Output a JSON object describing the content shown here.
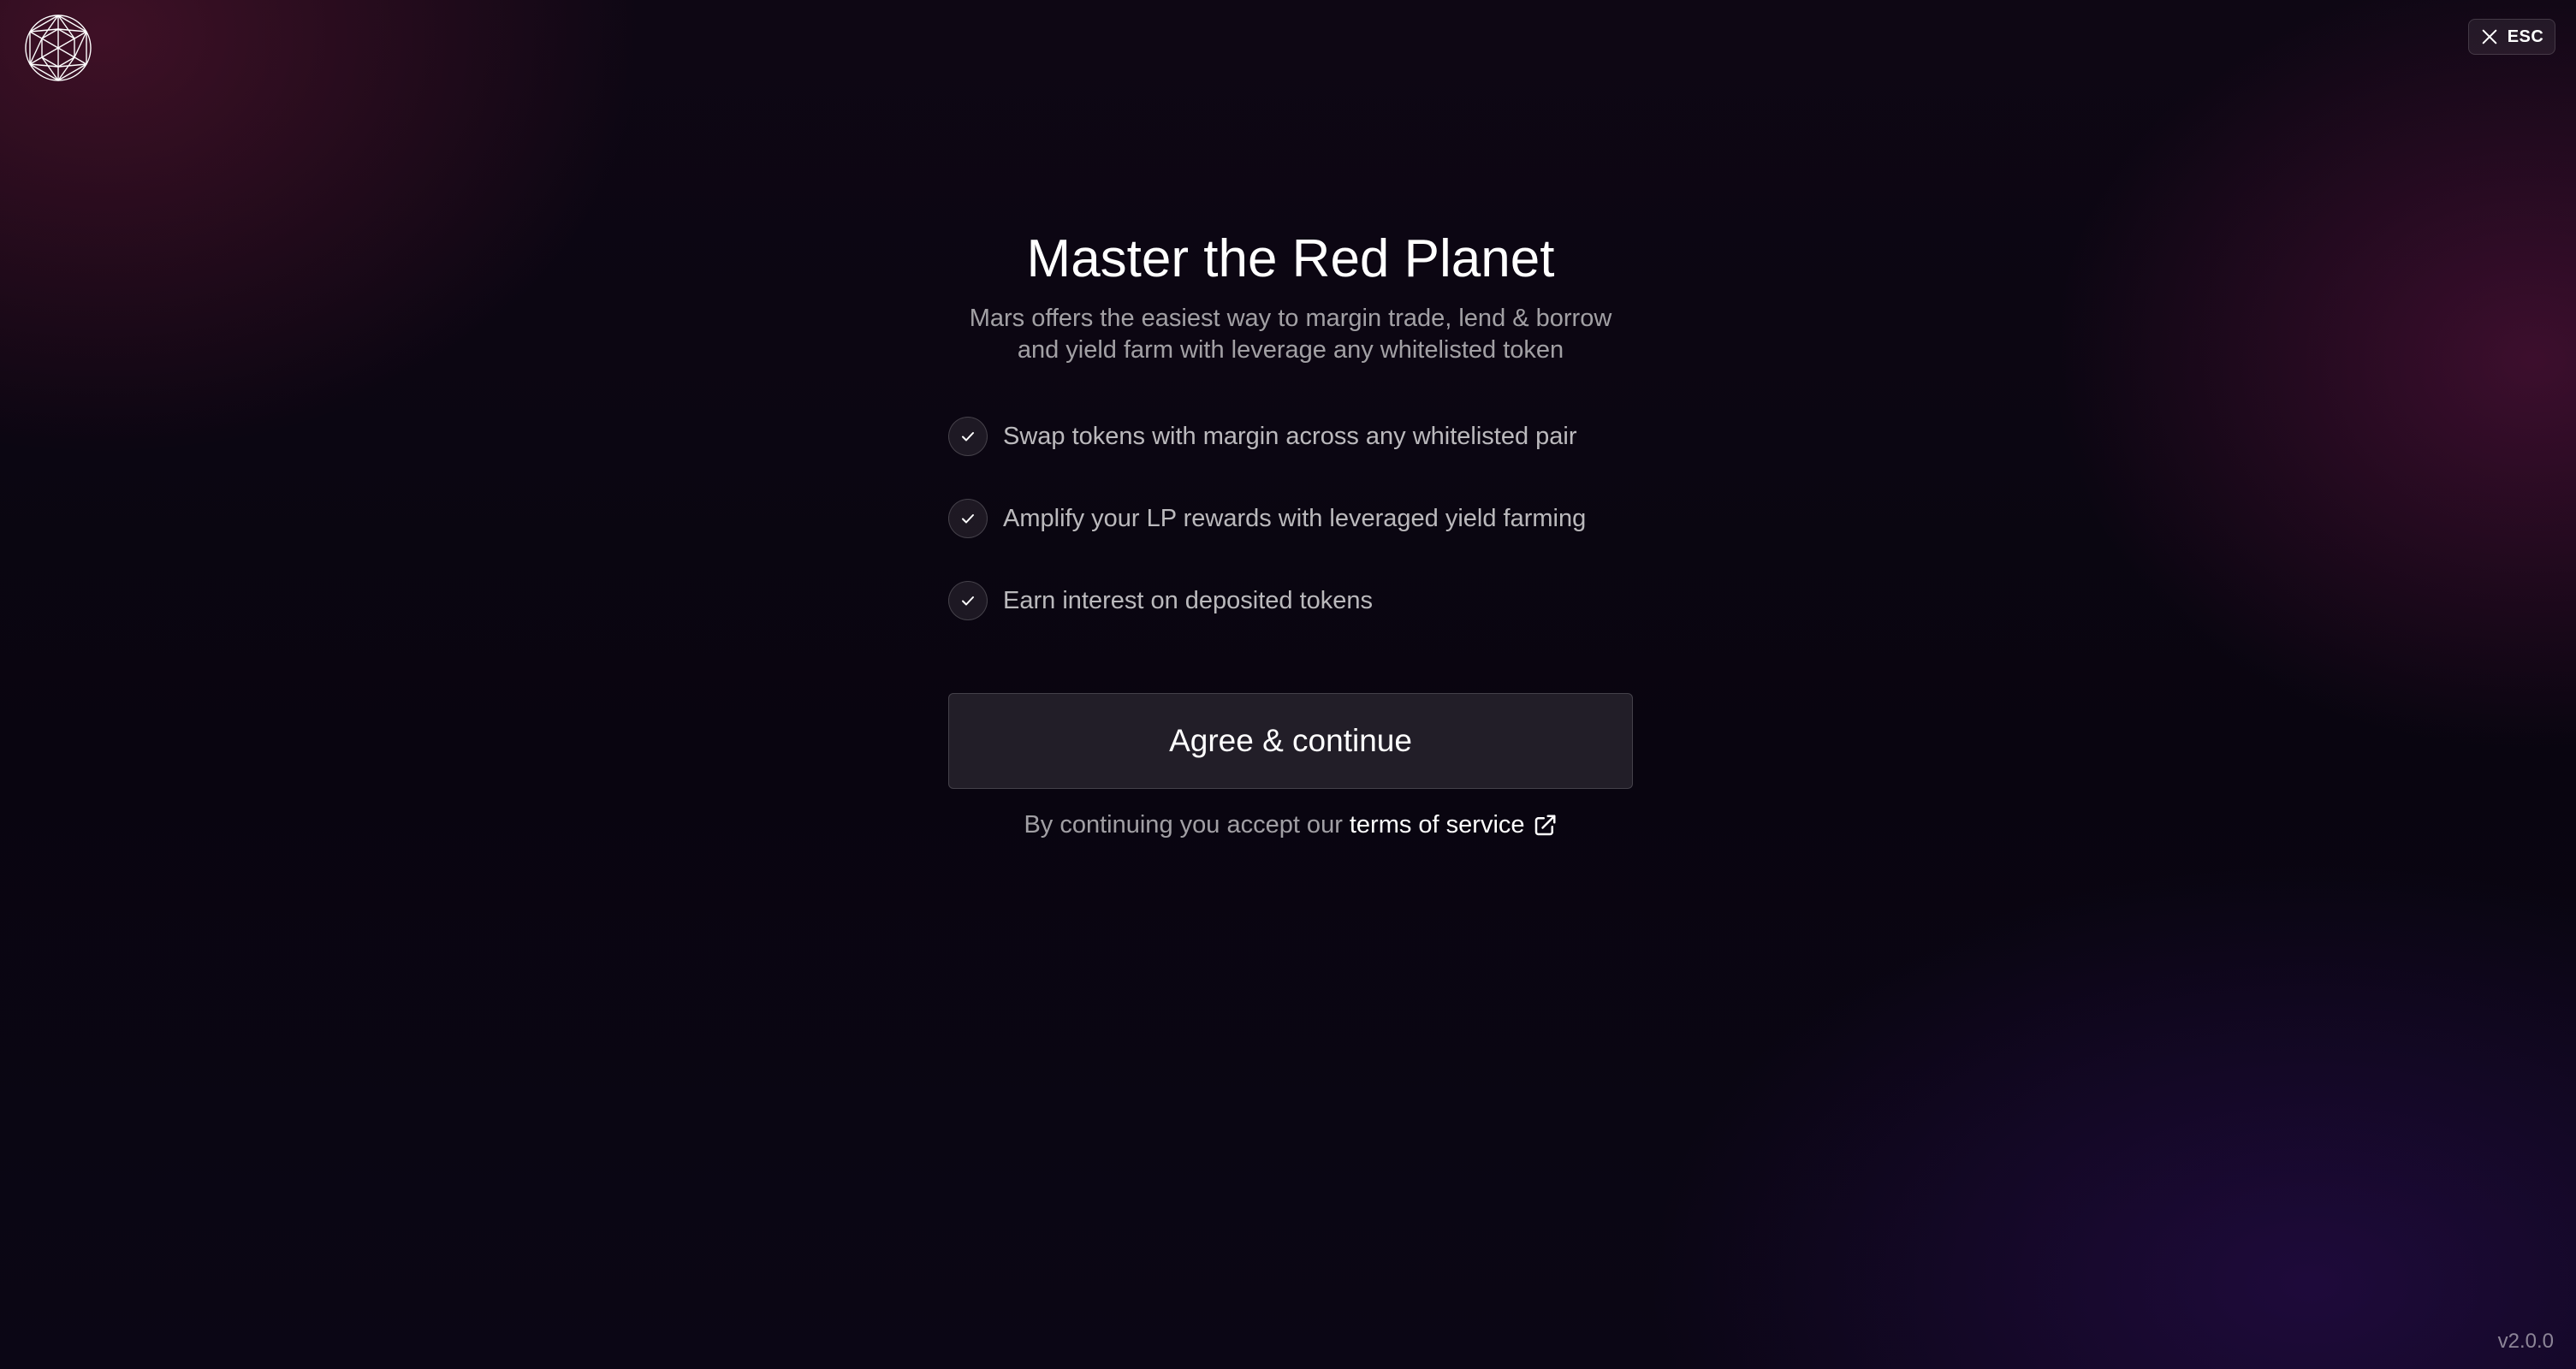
{
  "header": {
    "logo_icon": "mars-protocol-logo-icon",
    "close_icon": "close-icon",
    "esc_label": "ESC"
  },
  "main": {
    "title": "Master the Red Planet",
    "subtitle": "Mars offers the easiest way to margin trade, lend & borrow and yield farm with leverage any whitelisted token",
    "features": [
      {
        "icon": "check-icon",
        "text": "Swap tokens with margin across any whitelisted pair"
      },
      {
        "icon": "check-icon",
        "text": "Amplify your LP rewards with leveraged yield farming"
      },
      {
        "icon": "check-icon",
        "text": "Earn interest on deposited tokens"
      }
    ],
    "agree_button_label": "Agree & continue",
    "terms_prefix": "By continuing you accept our",
    "terms_link_label": "terms of service",
    "terms_link_icon": "external-link-icon"
  },
  "footer": {
    "version": "v2.0.0"
  }
}
